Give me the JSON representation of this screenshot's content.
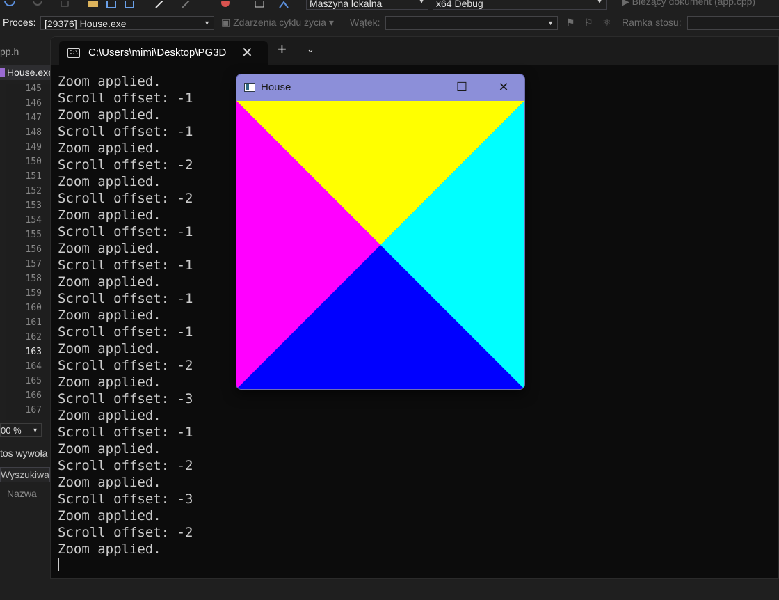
{
  "vs": {
    "machine_label": "Maszyna lokalna",
    "config_label": "x64 Debug",
    "current_doc_label": "Bieżący dokument (app.cpp)",
    "process_label": "Proces:",
    "process_value": "[29376] House.exe",
    "lifecycle_label": "Zdarzenia cyklu życia",
    "thread_label": "Wątek:",
    "stack_frame_label": "Ramka stosu:",
    "file_tab_1": "pp.h",
    "file_tab_2": "House.exe",
    "line_numbers": [
      "145",
      "146",
      "147",
      "148",
      "149",
      "150",
      "151",
      "152",
      "153",
      "154",
      "155",
      "156",
      "157",
      "158",
      "159",
      "160",
      "161",
      "162",
      "163",
      "164",
      "165",
      "166",
      "167"
    ],
    "current_line": "163",
    "zoom_value": "00 %",
    "call_stack_label": "tos wywoła",
    "search_label": "Wyszukiwan",
    "name_column": "Nazwa"
  },
  "terminal": {
    "tab_title": "C:\\Users\\mimi\\Desktop\\PG3D",
    "tab_icon_text": "C:\\",
    "lines": [
      "Zoom applied.",
      "Scroll offset: -1",
      "Zoom applied.",
      "Scroll offset: -1",
      "Zoom applied.",
      "Scroll offset: -2",
      "Zoom applied.",
      "Scroll offset: -2",
      "Zoom applied.",
      "Scroll offset: -1",
      "Zoom applied.",
      "Scroll offset: -1",
      "Zoom applied.",
      "Scroll offset: -1",
      "Zoom applied.",
      "Scroll offset: -1",
      "Zoom applied.",
      "Scroll offset: -2",
      "Zoom applied.",
      "Scroll offset: -3",
      "Zoom applied.",
      "Scroll offset: -1",
      "Zoom applied.",
      "Scroll offset: -2",
      "Zoom applied.",
      "Scroll offset: -3",
      "Zoom applied.",
      "Scroll offset: -2",
      "Zoom applied."
    ]
  },
  "house_window": {
    "title": "House",
    "minimize_glyph": "—",
    "maximize_glyph": "☐",
    "close_glyph": "✕",
    "colors": {
      "top": "#ffff00",
      "left": "#ff00ff",
      "right": "#00ffff",
      "bottom": "#0000ff",
      "titlebar": "#8c8fd9"
    }
  }
}
